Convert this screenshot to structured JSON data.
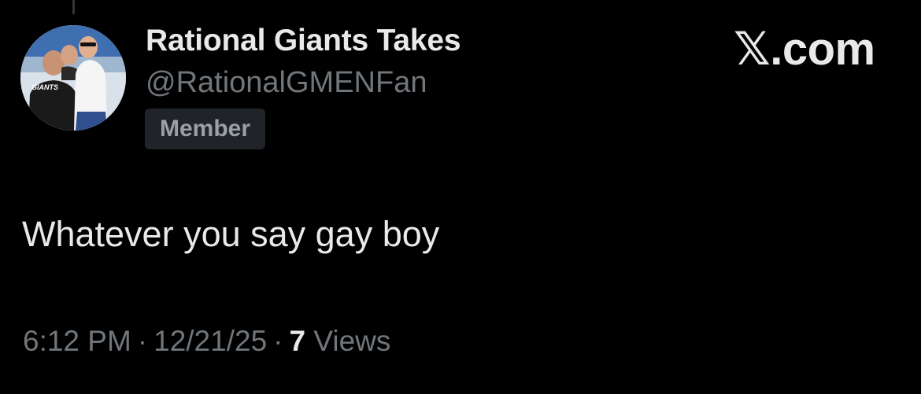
{
  "author": {
    "display_name": "Rational Giants Takes",
    "handle": "@RationalGMENFan",
    "badge": "Member",
    "avatar_text": "GIANTS"
  },
  "brand": {
    "label": "𝕏.com"
  },
  "post": {
    "text": "Whatever you say gay boy"
  },
  "meta": {
    "time": "6:12 PM",
    "separator": "·",
    "date": "12/21/25",
    "views_count": "7",
    "views_label": "Views"
  },
  "colors": {
    "background": "#000000",
    "primary_text": "#e7e9ea",
    "secondary_text": "#71767b",
    "badge_background": "#202327"
  }
}
